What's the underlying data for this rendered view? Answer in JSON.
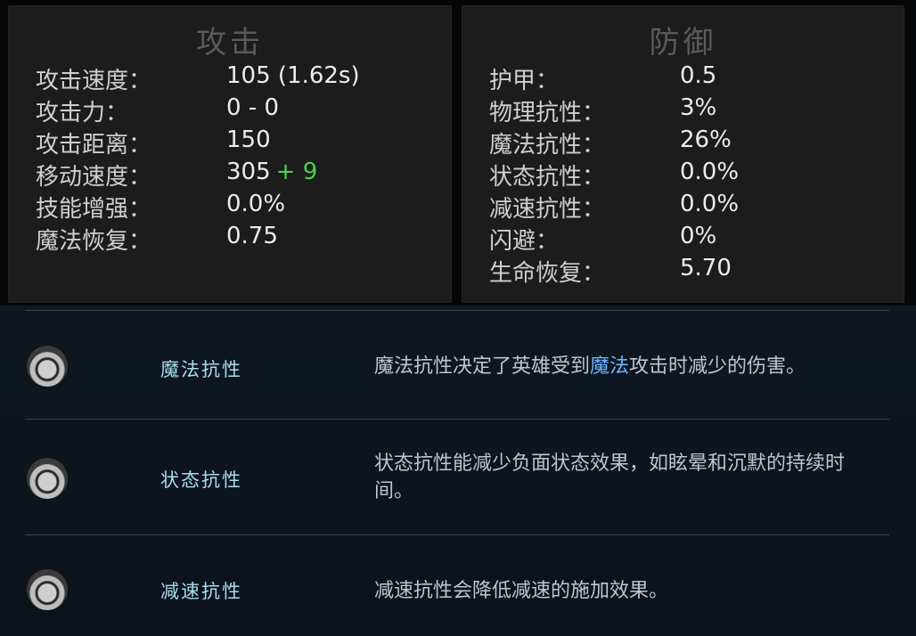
{
  "attack": {
    "title": "攻击",
    "stats": [
      {
        "label": "攻击速度：",
        "value": "105 (1.62s)"
      },
      {
        "label": "攻击力：",
        "value": "0 - 0"
      },
      {
        "label": "攻击距离：",
        "value": "150"
      },
      {
        "label": "移动速度：",
        "value": "305",
        "bonus": "+ 9"
      },
      {
        "label": "技能增强：",
        "value": "0.0%"
      },
      {
        "label": "魔法恢复：",
        "value": "0.75"
      }
    ]
  },
  "defense": {
    "title": "防御",
    "stats": [
      {
        "label": "护甲：",
        "value": "0.5"
      },
      {
        "label": "物理抗性：",
        "value": "3%"
      },
      {
        "label": "魔法抗性：",
        "value": "26%"
      },
      {
        "label": "状态抗性：",
        "value": "0.0%"
      },
      {
        "label": "减速抗性：",
        "value": "0.0%"
      },
      {
        "label": "闪避：",
        "value": "0%"
      },
      {
        "label": "生命恢复：",
        "value": "5.70"
      }
    ]
  },
  "info": [
    {
      "name": "魔法抗性",
      "desc_before": "魔法抗性决定了英雄受到",
      "desc_highlight": "魔法",
      "desc_after": "攻击时减少的伤害。"
    },
    {
      "name": "状态抗性",
      "desc_before": "状态抗性能减少负面状态效果，如眩晕和沉默的持续时间。",
      "desc_highlight": "",
      "desc_after": ""
    },
    {
      "name": "减速抗性",
      "desc_before": "减速抗性会降低减速的施加效果。",
      "desc_highlight": "",
      "desc_after": ""
    }
  ],
  "icons": {
    "info_icon": "ring-icon"
  },
  "colors": {
    "bonus": "#4bd04b",
    "highlight": "#6fb3ff",
    "info_name": "#a9dcef"
  }
}
